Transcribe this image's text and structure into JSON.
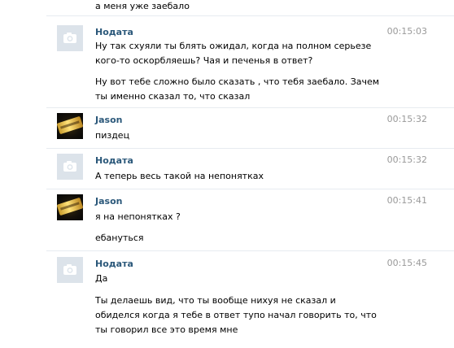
{
  "messages": [
    {
      "text": "а меня уже заебало"
    },
    {
      "author": "Нодата",
      "avatar_icon": "camera-icon",
      "time": "00:15:03",
      "texts": [
        "Ну так схуяли ты блять ожидал, когда на полном серьезе кого-то оскорбляешь? Чая и печенья в ответ?",
        "Ну вот тебе сложно было сказать , что тебя заебало. Зачем ты именно сказал то, что сказал"
      ]
    },
    {
      "author": "Jason",
      "time": "00:15:32",
      "texts": [
        "пиздец"
      ]
    },
    {
      "author": "Нодата",
      "avatar_icon": "camera-icon",
      "time": "00:15:32",
      "texts": [
        "А теперь весь такой на непонятках"
      ]
    },
    {
      "author": "Jason",
      "time": "00:15:41",
      "texts": [
        "я на непонятках ?",
        "ебануться"
      ]
    },
    {
      "author": "Нодата",
      "avatar_icon": "camera-icon",
      "time": "00:15:45",
      "texts": [
        "Да",
        "Ты делаешь вид, что ты вообще нихуя не сказал и обиделся когда я тебе в ответ тупо начал говорить то, что ты говорил все это время мне"
      ]
    }
  ],
  "colors": {
    "author_name": "#2b587a",
    "timestamp": "#999999",
    "separator": "#e7ebf0",
    "camera_avatar_bg": "#dce3ea"
  }
}
